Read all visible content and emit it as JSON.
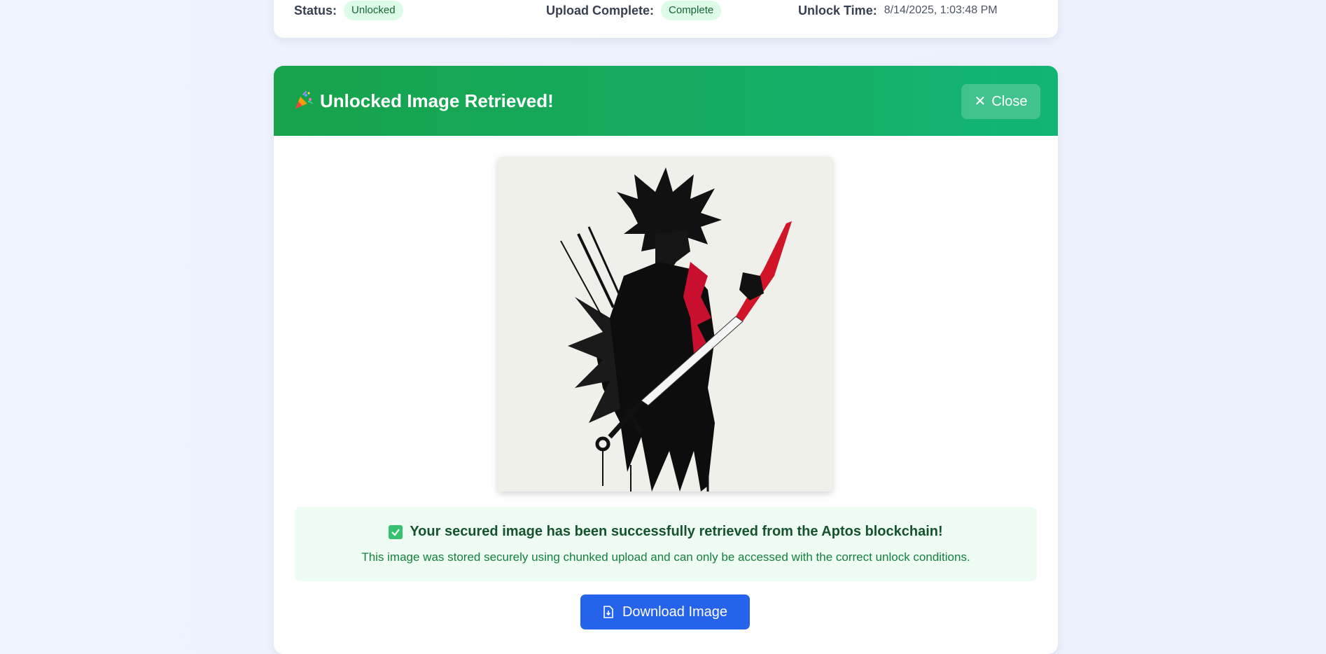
{
  "status_card": {
    "status_label": "Status:",
    "status_value": "Unlocked",
    "upload_label": "Upload Complete:",
    "upload_value": "Complete",
    "unlock_time_label": "Unlock Time:",
    "unlock_time_value": "8/14/2025, 1:03:48 PM"
  },
  "panel": {
    "title": "Unlocked Image Retrieved!",
    "title_icon": "party-popper-icon",
    "close_label": "Close",
    "close_icon": "close-icon",
    "success_icon": "check-box-icon",
    "success_title": "Your secured image has been successfully retrieved from the Aptos blockchain!",
    "success_desc": "This image was stored securely using chunked upload and can only be accessed with the correct unlock conditions.",
    "download_label": "Download Image",
    "download_icon": "file-download-icon"
  },
  "colors": {
    "header_gradient_start": "#17a24b",
    "header_gradient_end": "#13b574",
    "pill_bg": "#dcfce7",
    "pill_text": "#166534",
    "success_bg": "#effcf3",
    "download_button": "#2563eb",
    "page_bg": "#eef3fd"
  }
}
